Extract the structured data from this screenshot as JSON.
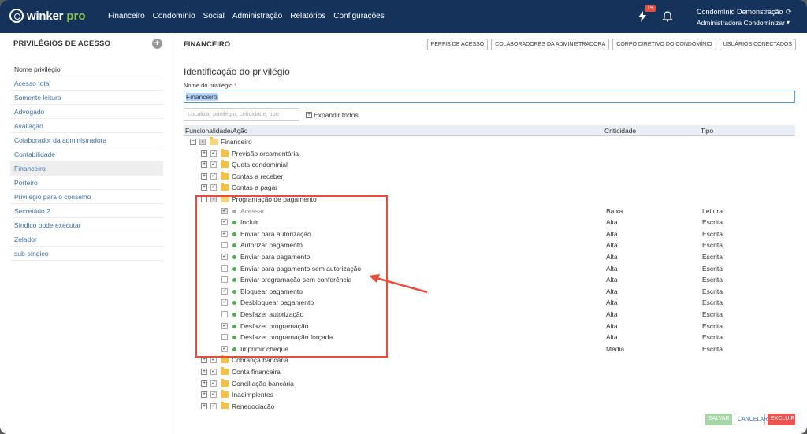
{
  "app": {
    "logo_text": "winker",
    "logo_suffix": "pro",
    "nav": [
      "Financeiro",
      "Condomínio",
      "Social",
      "Administração",
      "Relatórios",
      "Configurações"
    ],
    "notification_count": "19",
    "user_name": "Condomínio Demonstração",
    "user_org": "Administradora Condominizar"
  },
  "sidebar": {
    "title": "PRIVILÉGIOS DE ACESSO",
    "items": [
      {
        "label": "Nome privilégio"
      },
      {
        "label": "Acesso total"
      },
      {
        "label": "Somente leitura"
      },
      {
        "label": "Advogado"
      },
      {
        "label": "Avaliação"
      },
      {
        "label": "Colaborador da administradora"
      },
      {
        "label": "Contabilidade"
      },
      {
        "label": "Financeiro"
      },
      {
        "label": "Porteiro"
      },
      {
        "label": "Privilégio para o conselho"
      },
      {
        "label": "Secretário 2"
      },
      {
        "label": "Síndico pode executar"
      },
      {
        "label": "Zelador"
      },
      {
        "label": "sub-síndico"
      }
    ]
  },
  "main": {
    "title": "FINANCEIRO",
    "tab_buttons": [
      "PERFIS DE ACESSO",
      "COLABORADORES DA ADMINISTRADORA",
      "CORPO DIRETIVO DO CONDOMÍNIO",
      "USUÁRIOS CONECTADOS"
    ],
    "section_title": "Identificação do privilégio",
    "name_label": "Nome do privilégio",
    "name_required": "*",
    "name_value": "Financeiro",
    "search_placeholder": "Localizar privilégio, criticidade, tipo",
    "expand_all": "Expandir todos",
    "columns": {
      "func": "Funcionalidade/Ação",
      "crit": "Criticidade",
      "tipo": "Tipo"
    },
    "tree": [
      {
        "label": "Financeiro",
        "kind": "folder-open",
        "level": 0,
        "check": "partial"
      },
      {
        "label": "Previsão orcamentária",
        "kind": "folder",
        "level": 1,
        "check": "checked"
      },
      {
        "label": "Quota condominial",
        "kind": "folder",
        "level": 1,
        "check": "checked"
      },
      {
        "label": "Contas a receber",
        "kind": "folder",
        "level": 1,
        "check": "checked"
      },
      {
        "label": "Contas a pagar",
        "kind": "folder",
        "level": 1,
        "check": "checked"
      },
      {
        "label": "Programação de pagamento",
        "kind": "folder-open",
        "level": 1,
        "check": "partial"
      },
      {
        "label": "Acessar",
        "kind": "leaf",
        "level": 2,
        "check": "gray",
        "dot": "gray",
        "crit": "Baixa",
        "tipo": "Leitura"
      },
      {
        "label": "Incluir",
        "kind": "leaf",
        "level": 2,
        "check": "checked",
        "dot": "green",
        "crit": "Alta",
        "tipo": "Escrita"
      },
      {
        "label": "Enviar para autorização",
        "kind": "leaf",
        "level": 2,
        "check": "checked",
        "dot": "green",
        "crit": "Alta",
        "tipo": "Escrita"
      },
      {
        "label": "Autorizar pagamento",
        "kind": "leaf",
        "level": 2,
        "check": "unchecked",
        "dot": "green",
        "crit": "Alta",
        "tipo": "Escrita"
      },
      {
        "label": "Enviar para pagamento",
        "kind": "leaf",
        "level": 2,
        "check": "checked",
        "dot": "green",
        "crit": "Alta",
        "tipo": "Escrita"
      },
      {
        "label": "Enviar para pagamento sem autorização",
        "kind": "leaf",
        "level": 2,
        "check": "unchecked",
        "dot": "green",
        "crit": "Alta",
        "tipo": "Escrita"
      },
      {
        "label": "Enviar programação sem conferência",
        "kind": "leaf",
        "level": 2,
        "check": "unchecked",
        "dot": "green",
        "crit": "Alta",
        "tipo": "Escrita"
      },
      {
        "label": "Bloquear pagamento",
        "kind": "leaf",
        "level": 2,
        "check": "checked",
        "dot": "green",
        "crit": "Alta",
        "tipo": "Escrita"
      },
      {
        "label": "Desbloquear pagamento",
        "kind": "leaf",
        "level": 2,
        "check": "checked",
        "dot": "green",
        "crit": "Alta",
        "tipo": "Escrita"
      },
      {
        "label": "Desfazer autorização",
        "kind": "leaf",
        "level": 2,
        "check": "unchecked",
        "dot": "green",
        "crit": "Alta",
        "tipo": "Escrita"
      },
      {
        "label": "Desfazer programação",
        "kind": "leaf",
        "level": 2,
        "check": "checked",
        "dot": "green",
        "crit": "Alta",
        "tipo": "Escrita"
      },
      {
        "label": "Desfazer programação forçada",
        "kind": "leaf",
        "level": 2,
        "check": "unchecked",
        "dot": "green",
        "crit": "Alta",
        "tipo": "Escrita"
      },
      {
        "label": "Imprimir cheque",
        "kind": "leaf",
        "level": 2,
        "check": "checked",
        "dot": "green",
        "crit": "Média",
        "tipo": "Escrita"
      },
      {
        "label": "Cobrança bancária",
        "kind": "folder",
        "level": 1,
        "check": "checked"
      },
      {
        "label": "Conta financeira",
        "kind": "folder",
        "level": 1,
        "check": "checked"
      },
      {
        "label": "Conciliação bancária",
        "kind": "folder",
        "level": 1,
        "check": "checked"
      },
      {
        "label": "Inadimplentes",
        "kind": "folder",
        "level": 1,
        "check": "checked"
      },
      {
        "label": "Renegociação",
        "kind": "folder",
        "level": 1,
        "check": "checked"
      }
    ]
  },
  "footer": {
    "save": "SALVAR",
    "cancel": "CANCELAR",
    "delete": "EXCLUIR"
  },
  "colors": {
    "topbar": "#15335a",
    "accent_green": "#8bc34a",
    "highlight": "#e74c3c",
    "link": "#3a6ea5"
  }
}
